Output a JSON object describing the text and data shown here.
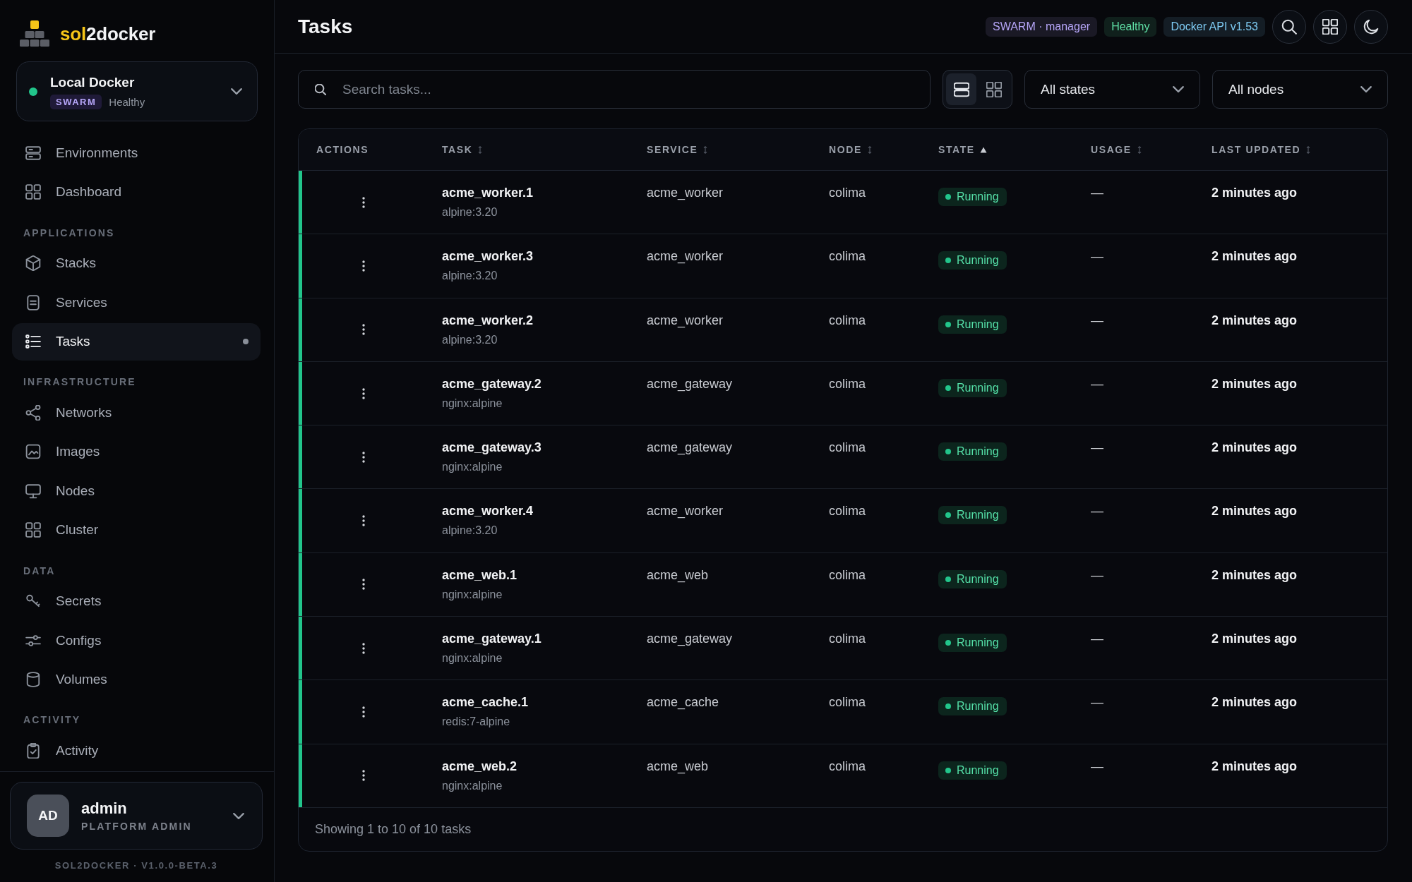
{
  "sidebar": {
    "brand": [
      {
        "text": "sol",
        "accent": true
      },
      {
        "text": "2docker",
        "accent": false
      }
    ],
    "environment": {
      "name": "Local Docker",
      "tag": "SWARM",
      "status": "Healthy",
      "online": true
    },
    "nav_groups": [
      {
        "items": [
          {
            "label": "Environments",
            "selected": false
          },
          {
            "label": "Dashboard",
            "selected": false
          }
        ]
      },
      {
        "heading": "APPLICATIONS",
        "items": [
          {
            "label": "Stacks",
            "selected": false
          },
          {
            "label": "Services",
            "selected": false
          },
          {
            "label": "Tasks",
            "selected": true
          }
        ]
      },
      {
        "heading": "INFRASTRUCTURE",
        "items": [
          {
            "label": "Networks",
            "selected": false
          },
          {
            "label": "Images",
            "selected": false
          },
          {
            "label": "Nodes",
            "selected": false
          },
          {
            "label": "Cluster",
            "selected": false
          }
        ]
      },
      {
        "heading": "DATA",
        "items": [
          {
            "label": "Secrets",
            "selected": false
          },
          {
            "label": "Configs",
            "selected": false
          },
          {
            "label": "Volumes",
            "selected": false
          }
        ]
      },
      {
        "heading": "ACTIVITY",
        "items": [
          {
            "label": "Activity",
            "selected": false
          }
        ]
      }
    ],
    "user": {
      "initials": "AD",
      "name": "admin",
      "role": "PLATFORM ADMIN"
    },
    "version": "SOL2DOCKER · V1.0.0-BETA.3"
  },
  "header": {
    "title": "Tasks",
    "tags": [
      {
        "text": "SWARM · manager",
        "color": "#b6a6f8"
      },
      {
        "text": "Healthy",
        "color": "#5fe0a6"
      },
      {
        "text": "Docker API v1.53",
        "color": "#7ecbf3"
      }
    ]
  },
  "toolbar": {
    "search": {
      "placeholder": "Search tasks..."
    },
    "view_modes": [
      {
        "selected": true
      },
      {
        "selected": false
      }
    ],
    "filters": [
      {
        "value": "All states"
      },
      {
        "value": "All nodes"
      }
    ]
  },
  "table": {
    "columns": [
      {
        "label": "ACTIONS",
        "sortable": false,
        "sorted": false
      },
      {
        "label": "TASK",
        "sortable": true,
        "sorted": false
      },
      {
        "label": "SERVICE",
        "sortable": true,
        "sorted": false
      },
      {
        "label": "NODE",
        "sortable": true,
        "sorted": false
      },
      {
        "label": "STATE",
        "sortable": true,
        "sorted": true
      },
      {
        "label": "USAGE",
        "sortable": true,
        "sorted": false
      },
      {
        "label": "LAST UPDATED",
        "sortable": true,
        "sorted": false
      }
    ],
    "rows": [
      {
        "task": "acme_worker.1",
        "image": "alpine:3.20",
        "service": "acme_worker",
        "node": "colima",
        "state": "Running",
        "color": "#22c58b",
        "usage": "—",
        "updated": "2 minutes ago"
      },
      {
        "task": "acme_worker.3",
        "image": "alpine:3.20",
        "service": "acme_worker",
        "node": "colima",
        "state": "Running",
        "color": "#22c58b",
        "usage": "—",
        "updated": "2 minutes ago"
      },
      {
        "task": "acme_worker.2",
        "image": "alpine:3.20",
        "service": "acme_worker",
        "node": "colima",
        "state": "Running",
        "color": "#22c58b",
        "usage": "—",
        "updated": "2 minutes ago"
      },
      {
        "task": "acme_gateway.2",
        "image": "nginx:alpine",
        "service": "acme_gateway",
        "node": "colima",
        "state": "Running",
        "color": "#22c58b",
        "usage": "—",
        "updated": "2 minutes ago"
      },
      {
        "task": "acme_gateway.3",
        "image": "nginx:alpine",
        "service": "acme_gateway",
        "node": "colima",
        "state": "Running",
        "color": "#22c58b",
        "usage": "—",
        "updated": "2 minutes ago"
      },
      {
        "task": "acme_worker.4",
        "image": "alpine:3.20",
        "service": "acme_worker",
        "node": "colima",
        "state": "Running",
        "color": "#22c58b",
        "usage": "—",
        "updated": "2 minutes ago"
      },
      {
        "task": "acme_web.1",
        "image": "nginx:alpine",
        "service": "acme_web",
        "node": "colima",
        "state": "Running",
        "color": "#22c58b",
        "usage": "—",
        "updated": "2 minutes ago"
      },
      {
        "task": "acme_gateway.1",
        "image": "nginx:alpine",
        "service": "acme_gateway",
        "node": "colima",
        "state": "Running",
        "color": "#22c58b",
        "usage": "—",
        "updated": "2 minutes ago"
      },
      {
        "task": "acme_cache.1",
        "image": "redis:7-alpine",
        "service": "acme_cache",
        "node": "colima",
        "state": "Running",
        "color": "#22c58b",
        "usage": "—",
        "updated": "2 minutes ago"
      },
      {
        "task": "acme_web.2",
        "image": "nginx:alpine",
        "service": "acme_web",
        "node": "colima",
        "state": "Running",
        "color": "#22c58b",
        "usage": "—",
        "updated": "2 minutes ago"
      }
    ],
    "footer": "Showing 1 to 10 of 10 tasks"
  }
}
